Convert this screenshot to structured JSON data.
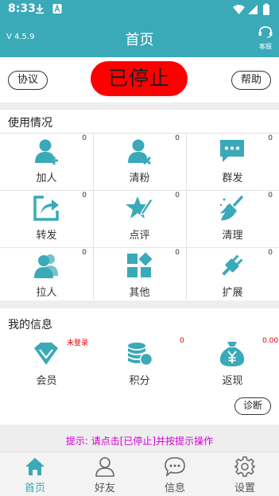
{
  "status_bar": {
    "time": "8:33"
  },
  "header": {
    "version": "V 4.5.9",
    "title": "首页",
    "service_label": "客服"
  },
  "control": {
    "protocol_label": "协议",
    "stop_label": "已停止",
    "help_label": "帮助"
  },
  "usage": {
    "title": "使用情况",
    "items": [
      {
        "label": "加人",
        "count": "0",
        "icon": "add-person-icon"
      },
      {
        "label": "清粉",
        "count": "0",
        "icon": "remove-person-icon"
      },
      {
        "label": "群发",
        "count": "0",
        "icon": "chat-bubble-icon"
      },
      {
        "label": "转发",
        "count": "0",
        "icon": "share-icon"
      },
      {
        "label": "点评",
        "count": "0",
        "icon": "star-pen-icon"
      },
      {
        "label": "清理",
        "count": "0",
        "icon": "broom-icon"
      },
      {
        "label": "拉人",
        "count": "0",
        "icon": "group-people-icon"
      },
      {
        "label": "其他",
        "count": "0",
        "icon": "blocks-icon"
      },
      {
        "label": "扩展",
        "count": "0",
        "icon": "plug-icon"
      }
    ]
  },
  "my_info": {
    "title": "我的信息",
    "items": [
      {
        "label": "会员",
        "value": "未登录",
        "icon": "diamond-icon"
      },
      {
        "label": "积分",
        "value": "0",
        "icon": "coins-icon"
      },
      {
        "label": "返现",
        "value": "0.00",
        "icon": "money-bag-icon"
      }
    ],
    "diagnose_label": "诊断"
  },
  "hint": "提示: 请点击[已停止]并按提示操作",
  "bottom_nav": [
    {
      "label": "首页",
      "icon": "home-icon",
      "active": true
    },
    {
      "label": "好友",
      "icon": "friends-icon",
      "active": false
    },
    {
      "label": "信息",
      "icon": "message-icon",
      "active": false
    },
    {
      "label": "设置",
      "icon": "settings-icon",
      "active": false
    }
  ],
  "colors": {
    "primary": "#3aa9b8",
    "stop": "#ff0000",
    "hint": "#d000d0",
    "alert": "#e00000"
  }
}
